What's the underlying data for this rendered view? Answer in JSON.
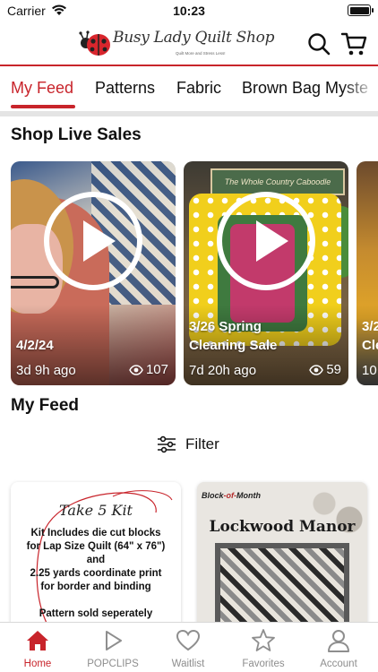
{
  "status_bar": {
    "carrier": "Carrier",
    "time": "10:23"
  },
  "header": {
    "logo_title": "Busy Lady Quilt Shop",
    "logo_tagline": "Quilt More and Stress Less!",
    "search_icon": "search-icon",
    "cart_icon": "cart-icon"
  },
  "tabs": [
    {
      "label": "My Feed",
      "active": true
    },
    {
      "label": "Patterns",
      "active": false
    },
    {
      "label": "Fabric",
      "active": false
    },
    {
      "label": "Brown Bag Myste",
      "active": false
    }
  ],
  "live_sales": {
    "title": "Shop Live Sales",
    "cards": [
      {
        "title": "4/2/24",
        "ago": "3d 9h ago",
        "views": "107"
      },
      {
        "title": "3/26 Spring\nCleaning Sale",
        "sign": "The Whole Country Caboodle",
        "ago": "7d 20h ago",
        "views": "59"
      },
      {
        "title": "3/2\nCle",
        "ago": "10"
      }
    ]
  },
  "feed": {
    "title": "My Feed",
    "filter_label": "Filter",
    "cards": [
      {
        "kit_title": "Take 5 Kit",
        "lines": [
          "Kit Includes die cut blocks",
          "for  Lap Size Quilt (64\" x 76\")",
          "and",
          "2.25 yards coordinate print",
          "for border and binding",
          "",
          "Pattern sold seperately"
        ]
      },
      {
        "badge_a": "Block",
        "badge_b": "-of-",
        "badge_c": "Month",
        "title": "Lockwood Manor"
      }
    ]
  },
  "bottom_tabs": [
    {
      "label": "Home",
      "icon": "home-icon",
      "active": true
    },
    {
      "label": "POPCLIPS",
      "icon": "play-icon",
      "active": false
    },
    {
      "label": "Waitlist",
      "icon": "heart-icon",
      "active": false
    },
    {
      "label": "Favorites",
      "icon": "star-icon",
      "active": false
    },
    {
      "label": "Account",
      "icon": "account-icon",
      "active": false
    }
  ],
  "colors": {
    "accent": "#c8242b",
    "inactive": "#8e8e8e"
  }
}
